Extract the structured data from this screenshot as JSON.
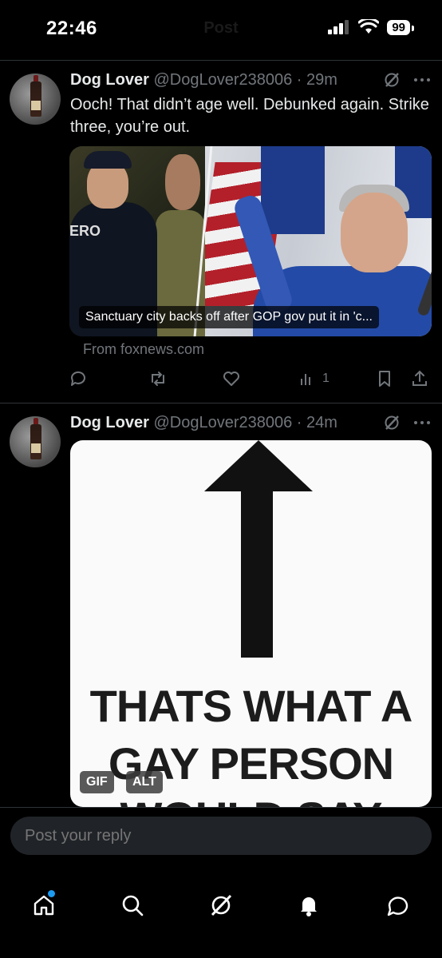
{
  "status_bar": {
    "time": "22:46",
    "title": "Post",
    "battery": "99"
  },
  "posts": [
    {
      "name": "Dog Lover",
      "handle": "@DogLover238006",
      "time": "29m",
      "text": "Ooch!  That didn’t age well. Debunked again. Strike three, you’re out.",
      "card": {
        "caption": "Sanctuary city backs off after GOP gov put it in 'c...",
        "left_badge": "ERO",
        "source": "From foxnews.com"
      },
      "actions": {
        "views": "1"
      }
    },
    {
      "name": "Dog Lover",
      "handle": "@DogLover238006",
      "time": "24m",
      "meme": {
        "line1": "THATS WHAT A",
        "line2": "GAY PERSON",
        "line3": "WOULD SAY",
        "gif_badge": "GIF",
        "alt_badge": "ALT"
      }
    }
  ],
  "reply": {
    "placeholder": "Post your reply"
  },
  "nav": {
    "items": [
      "home-icon",
      "search-icon",
      "grok-icon",
      "notifications-icon",
      "messages-icon"
    ],
    "accent": "#1d9bf0"
  }
}
